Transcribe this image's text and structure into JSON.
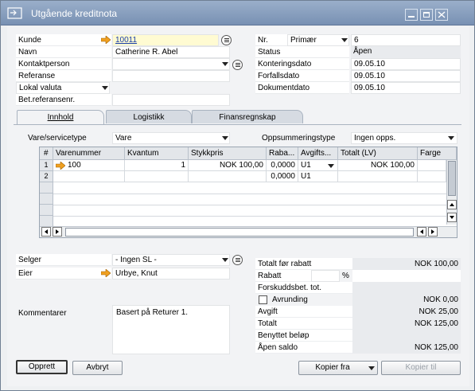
{
  "window": {
    "title": "Utgående kreditnota",
    "minimize_label": "_",
    "maximize_label": "□",
    "close_label": "×"
  },
  "header_left": {
    "kunde_label": "Kunde",
    "kunde_value": "10011",
    "navn_label": "Navn",
    "navn_value": "Catherine R. Abel",
    "kontaktperson_label": "Kontaktperson",
    "kontaktperson_value": "",
    "referanse_label": "Referanse",
    "referanse_value": "",
    "valuta_value": "Lokal valuta",
    "betref_label": "Bet.referansenr.",
    "betref_value": ""
  },
  "header_right": {
    "nr_label": "Nr.",
    "nr_series": "Primær",
    "nr_value": "6",
    "status_label": "Status",
    "status_value": "Åpen",
    "konteringsdato_label": "Konteringsdato",
    "konteringsdato_value": "09.05.10",
    "forfallsdato_label": "Forfallsdato",
    "forfallsdato_value": "09.05.10",
    "dokumentdato_label": "Dokumentdato",
    "dokumentdato_value": "09.05.10"
  },
  "tabs": [
    {
      "label": "Innhold"
    },
    {
      "label": "Logistikk"
    },
    {
      "label": "Finansregnskap"
    }
  ],
  "content_tab": {
    "vare_label": "Vare/servicetype",
    "vare_value": "Vare",
    "oppsummering_label": "Oppsummeringstype",
    "oppsummering_value": "Ingen opps."
  },
  "grid": {
    "columns": [
      "#",
      "Varenummer",
      "Kvantum",
      "Stykkpris",
      "Raba...",
      "Avgifts...",
      "Totalt (LV)",
      "Farge"
    ],
    "rows": [
      {
        "num": "1",
        "varenummer": "100",
        "kvantum": "1",
        "stykkpris": "NOK 100,00",
        "rabatt": "0,0000",
        "avgift": "U1",
        "totalt": "NOK 100,00",
        "farge": ""
      },
      {
        "num": "2",
        "varenummer": "",
        "kvantum": "",
        "stykkpris": "",
        "rabatt": "0,0000",
        "avgift": "U1",
        "totalt": "",
        "farge": ""
      }
    ]
  },
  "footer_left": {
    "selger_label": "Selger",
    "selger_value": "- Ingen SL -",
    "eier_label": "Eier",
    "eier_value": "Urbye, Knut",
    "kommentarer_label": "Kommentarer",
    "kommentarer_value": "Basert på Returer 1."
  },
  "totals": {
    "total_for_rabatt_label": "Totalt før rabatt",
    "total_for_rabatt_value": "NOK 100,00",
    "rabatt_label": "Rabatt",
    "rabatt_value": "",
    "rabatt_pct": "%",
    "forskudd_label": "Forskuddsbet. tot.",
    "forskudd_value": "",
    "avrunding_label": "Avrunding",
    "avrunding_value": "NOK 0,00",
    "avgift_label": "Avgift",
    "avgift_value": "NOK 25,00",
    "totalt_label": "Totalt",
    "totalt_value": "NOK 125,00",
    "benyttet_label": "Benyttet beløp",
    "benyttet_value": "",
    "apen_saldo_label": "Åpen saldo",
    "apen_saldo_value": "NOK 125,00"
  },
  "buttons": {
    "opprett": "Opprett",
    "avbryt": "Avbryt",
    "kopier_fra": "Kopier fra",
    "kopier_til": "Kopier til"
  }
}
